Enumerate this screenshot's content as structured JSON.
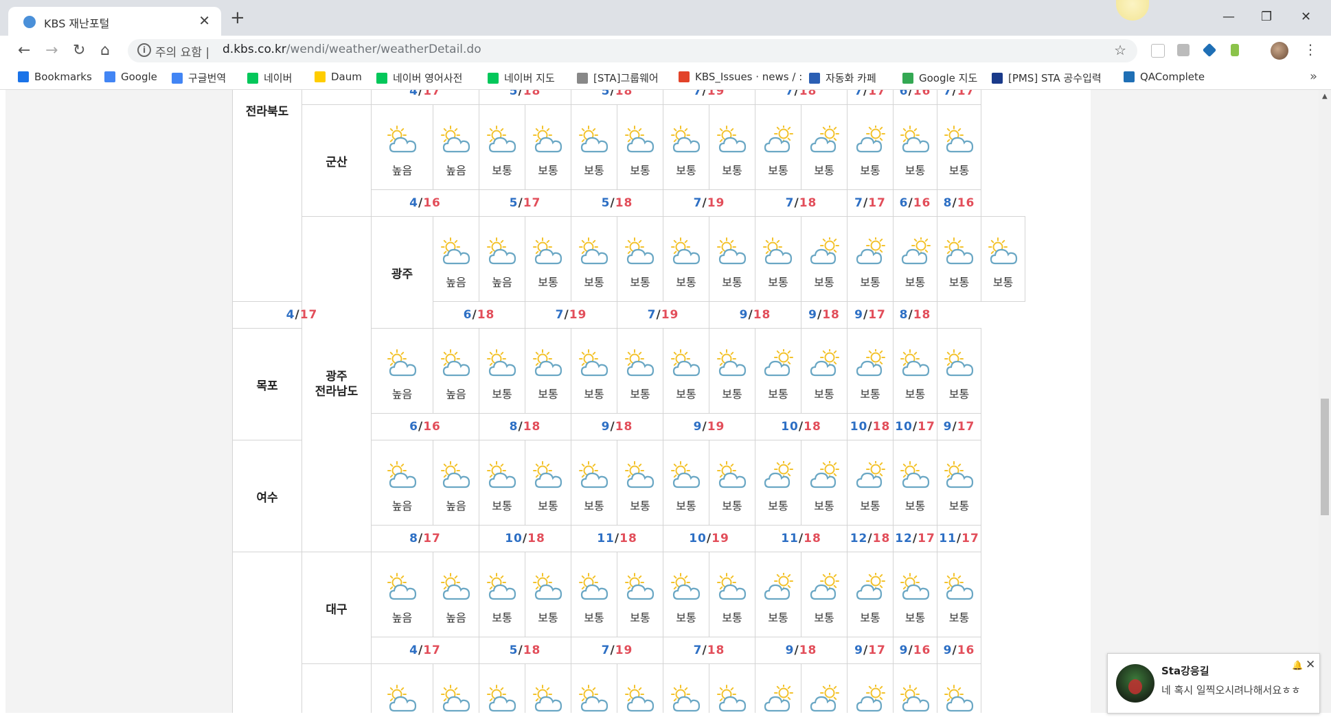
{
  "browser": {
    "tab_title": "KBS 재난포털",
    "tab_close": "✕",
    "new_tab": "+",
    "win_minimize": "—",
    "win_restore": "❐",
    "win_close": "✕",
    "security_label": "주의 요함",
    "url_host": "d.kbs.co.kr",
    "url_path": "/wendi/weather/weatherDetail.do",
    "bookmarks": [
      {
        "label": "Bookmarks",
        "icon": "star-icon",
        "color": "#1a73e8"
      },
      {
        "label": "Google",
        "icon": "google-icon",
        "color": "#4285f4"
      },
      {
        "label": "구글번역",
        "icon": "translate-icon",
        "color": "#4285f4"
      },
      {
        "label": "네이버",
        "icon": "naver-icon",
        "color": "#03c75a"
      },
      {
        "label": "Daum",
        "icon": "daum-icon",
        "color": "#ffcd00"
      },
      {
        "label": "네이버 영어사전",
        "icon": "dict-icon",
        "color": "#03c75a"
      },
      {
        "label": "네이버 지도",
        "icon": "naver-map-icon",
        "color": "#03c75a"
      },
      {
        "label": "[STA]그룹웨어",
        "icon": "page-icon",
        "color": "#888888"
      },
      {
        "label": "KBS_Issues · news / :",
        "icon": "gitlab-icon",
        "color": "#e24329"
      },
      {
        "label": "자동화 카페",
        "icon": "sta-icon",
        "color": "#2b5fb4"
      },
      {
        "label": "Google 지도",
        "icon": "maps-icon",
        "color": "#34a853"
      },
      {
        "label": "[PMS] STA 공수입력",
        "icon": "pms-icon",
        "color": "#1a3a8a"
      },
      {
        "label": "QAComplete",
        "icon": "qa-icon",
        "color": "#1f6fb5"
      }
    ],
    "bookmarks_more": "»"
  },
  "weather": {
    "legend": {
      "high": "높음",
      "normal": "보통"
    },
    "top_partial_row": {
      "region": "전라북도",
      "temps": [
        [
          "4",
          "17"
        ],
        [
          "5",
          "18"
        ],
        [
          "5",
          "18"
        ],
        [
          "7",
          "19"
        ],
        [
          "7",
          "18"
        ],
        [
          "7",
          "17"
        ],
        [
          "6",
          "16"
        ],
        [
          "7",
          "17"
        ]
      ]
    },
    "groups": [
      {
        "region": "전라북도",
        "region_display": "",
        "cities": [
          {
            "name": "군산",
            "temps": [
              [
                "4",
                "16"
              ],
              [
                "5",
                "17"
              ],
              [
                "5",
                "18"
              ],
              [
                "7",
                "19"
              ],
              [
                "7",
                "18"
              ],
              [
                "7",
                "17"
              ],
              [
                "6",
                "16"
              ],
              [
                "8",
                "16"
              ]
            ]
          }
        ]
      },
      {
        "region": "광주 전라남도",
        "region_line1": "광주",
        "region_line2": "전라남도",
        "cities": [
          {
            "name": "광주",
            "temps": [
              [
                "4",
                "17"
              ],
              [
                "6",
                "18"
              ],
              [
                "7",
                "19"
              ],
              [
                "7",
                "19"
              ],
              [
                "9",
                "18"
              ],
              [
                "9",
                "18"
              ],
              [
                "9",
                "17"
              ],
              [
                "8",
                "18"
              ]
            ]
          },
          {
            "name": "목포",
            "temps": [
              [
                "6",
                "16"
              ],
              [
                "8",
                "18"
              ],
              [
                "9",
                "18"
              ],
              [
                "9",
                "19"
              ],
              [
                "10",
                "18"
              ],
              [
                "10",
                "18"
              ],
              [
                "10",
                "17"
              ],
              [
                "9",
                "17"
              ]
            ]
          },
          {
            "name": "여수",
            "temps": [
              [
                "8",
                "17"
              ],
              [
                "10",
                "18"
              ],
              [
                "11",
                "18"
              ],
              [
                "10",
                "19"
              ],
              [
                "11",
                "18"
              ],
              [
                "12",
                "18"
              ],
              [
                "12",
                "17"
              ],
              [
                "11",
                "17"
              ]
            ]
          }
        ]
      },
      {
        "region": "",
        "cities": [
          {
            "name": "대구",
            "temps": [
              [
                "4",
                "17"
              ],
              [
                "5",
                "18"
              ],
              [
                "7",
                "19"
              ],
              [
                "7",
                "18"
              ],
              [
                "9",
                "18"
              ],
              [
                "9",
                "17"
              ],
              [
                "9",
                "16"
              ],
              [
                "9",
                "16"
              ]
            ]
          }
        ]
      }
    ],
    "slot_labels": [
      "높음",
      "높음",
      "보통",
      "보통",
      "보통",
      "보통",
      "보통",
      "보통",
      "보통",
      "보통",
      "보통",
      "보통",
      "보통"
    ],
    "slot_icons": [
      "sun-cloud",
      "sun-cloud",
      "sun-cloud",
      "sun-cloud",
      "sun-cloud",
      "sun-cloud",
      "sun-cloud",
      "sun-cloud",
      "cloud-sun",
      "cloud-sun",
      "cloud-sun",
      "sun-cloud",
      "sun-cloud"
    ]
  },
  "chat": {
    "sender": "Sta강응길",
    "message": "네 혹시 일찍오시려나해서요ㅎㅎ",
    "bell": "🔔",
    "close": "✕"
  }
}
